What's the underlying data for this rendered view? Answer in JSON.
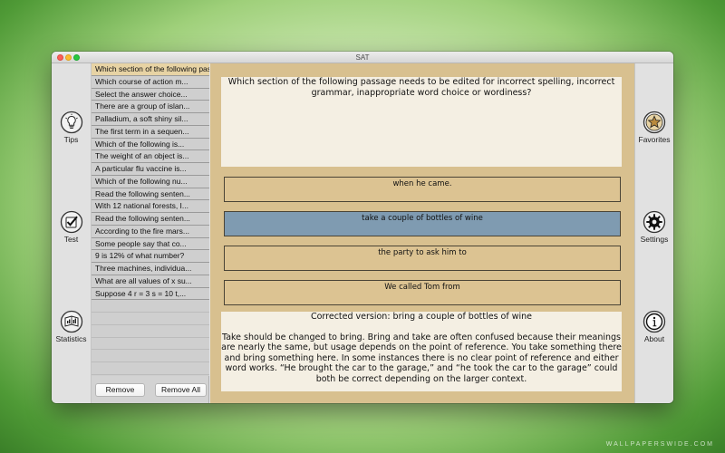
{
  "window": {
    "title": "SAT"
  },
  "left_sidebar": [
    {
      "label": "Tips",
      "icon": "lightbulb-icon"
    },
    {
      "label": "Test",
      "icon": "checkmark-icon"
    },
    {
      "label": "Statistics",
      "icon": "chart-book-icon"
    }
  ],
  "right_sidebar": [
    {
      "label": "Favorites",
      "icon": "star-icon"
    },
    {
      "label": "Settings",
      "icon": "gear-icon"
    },
    {
      "label": "About",
      "icon": "info-icon"
    }
  ],
  "question_list": {
    "items": [
      "Which section of the following passage needs to be edited for incorrect spelling, incorrect grammar, inappropriate word choice or wordiness?",
      "Which course of action m...",
      "Select the answer choice...",
      "There are a group of islan...",
      "Palladium, a soft shiny sil...",
      "The first term in a sequen...",
      "Which of the following is...",
      "The weight of an object is...",
      "A particular flu vaccine is...",
      "Which of the following nu...",
      "Read the following senten...",
      "With 12 national forests, I...",
      "Read the following senten...",
      "According to the fire mars...",
      "Some people say that co...",
      "9 is 12% of what number?",
      "Three machines, individua...",
      "What are all values of x su...",
      "Suppose 4 r = 3 s = 10 t,..."
    ],
    "selected_index": 0,
    "remove_label": "Remove",
    "remove_all_label": "Remove All"
  },
  "question": {
    "text": "Which section of the following passage needs to be edited for incorrect spelling, incorrect grammar, inappropriate word choice or wordiness?"
  },
  "options": [
    {
      "text": "when he came.",
      "selected": false
    },
    {
      "text": "take a couple of bottles of wine",
      "selected": true
    },
    {
      "text": "the party to ask him to",
      "selected": false
    },
    {
      "text": "We called Tom from",
      "selected": false
    }
  ],
  "answer": {
    "heading": "Corrected version: bring a couple of bottles of wine",
    "explanation": "Take should be changed to bring. Bring and take are often confused because their meanings are nearly the same, but usage depends on the point of reference. You take something there and bring something here. In some instances there is no clear point of reference and either word works. “He brought the car to the garage,” and “he took the car to the garage” could both be correct depending on the larger context."
  },
  "watermark": "WALLPAPERSWIDE.COM",
  "colors": {
    "selected_list_item": "#e7d3a4",
    "main_background": "#d8c08f",
    "selected_option": "#7f9bb1"
  }
}
